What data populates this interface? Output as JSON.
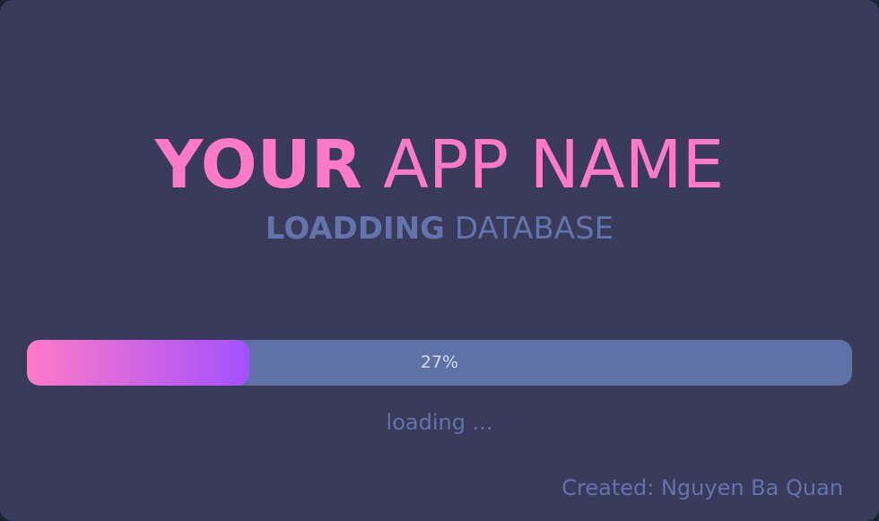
{
  "app": {
    "title_bold": "YOUR",
    "title_light": "APP NAME"
  },
  "subtitle": {
    "bold": "LOADDING",
    "light": "DATABASE"
  },
  "progress": {
    "value": 27,
    "label": "27%",
    "status": "loading ..."
  },
  "footer": {
    "credit": "Created: Nguyen Ba Quan"
  },
  "colors": {
    "background": "#383b59",
    "accent_pink": "#ff7ac6",
    "accent_purple": "#a351ff",
    "muted_blue": "#6473aa",
    "track_blue": "#5f72a5"
  }
}
